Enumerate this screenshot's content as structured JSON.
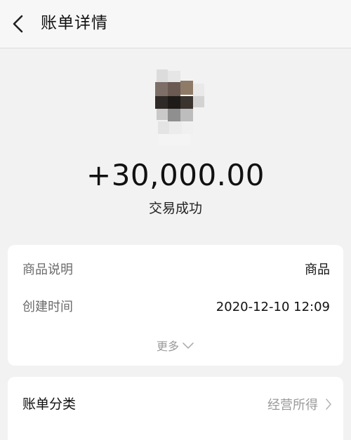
{
  "header": {
    "title": "账单详情",
    "back_icon": "chevron-left-icon"
  },
  "summary": {
    "amount": "+30,000.00",
    "status": "交易成功"
  },
  "details": {
    "rows": [
      {
        "label": "商品说明",
        "value": "商品"
      },
      {
        "label": "创建时间",
        "value": "2020-12-10 12:09"
      }
    ],
    "more_label": "更多",
    "more_icon": "chevron-down-icon"
  },
  "category": {
    "label": "账单分类",
    "value": "经营所得",
    "icon": "chevron-right-icon"
  },
  "colors": {
    "background": "#f2f2f2",
    "card": "#ffffff",
    "secondary_text": "#9a9a9a"
  }
}
